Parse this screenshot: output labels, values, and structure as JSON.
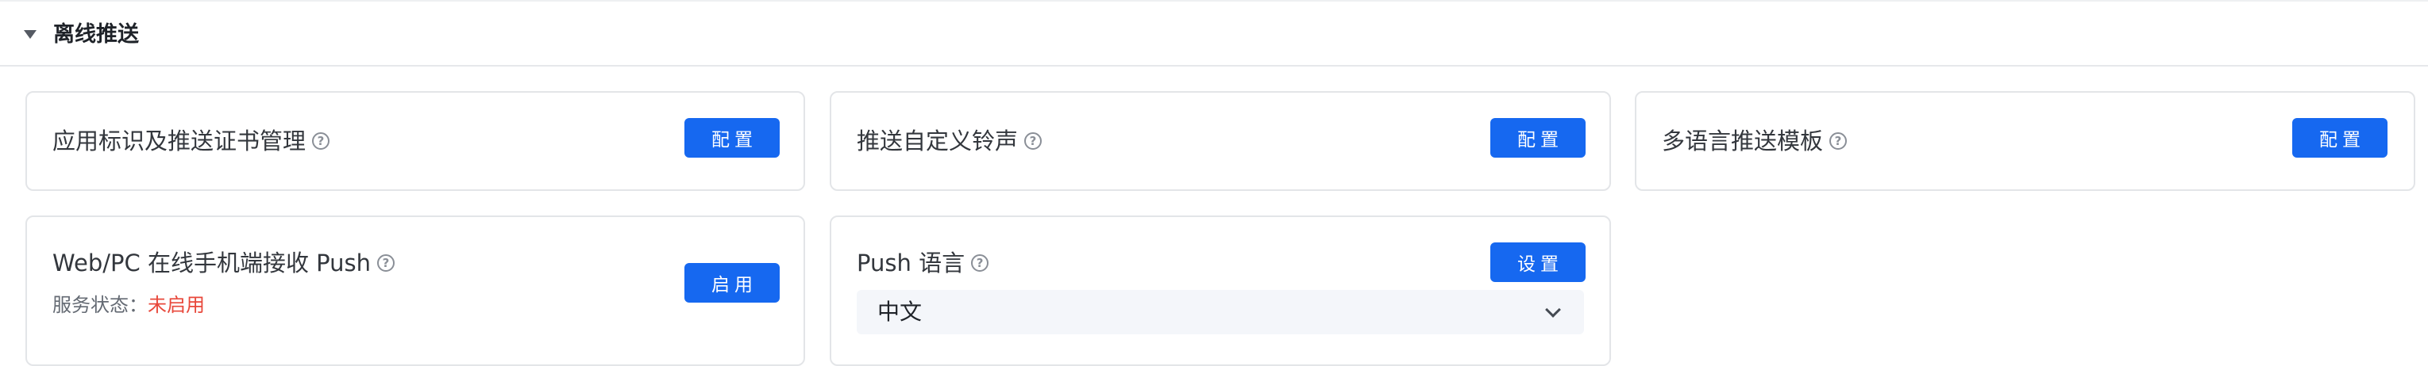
{
  "section": {
    "title": "离线推送"
  },
  "cards": {
    "app_cert": {
      "title": "应用标识及推送证书管理",
      "button": "配置"
    },
    "ringtone": {
      "title": "推送自定义铃声",
      "button": "配置"
    },
    "multilang": {
      "title": "多语言推送模板",
      "button": "配置"
    },
    "web_pc_push": {
      "title": "Web/PC 在线手机端接收 Push",
      "button": "启用",
      "status_label": "服务状态：",
      "status_value": "未启用"
    },
    "push_lang": {
      "title": "Push 语言",
      "button": "设置",
      "selected": "中文"
    }
  },
  "icons": {
    "help": "?"
  },
  "colors": {
    "primary": "#1668f0",
    "status_off": "#e8483b",
    "border": "#e3e5e8"
  }
}
